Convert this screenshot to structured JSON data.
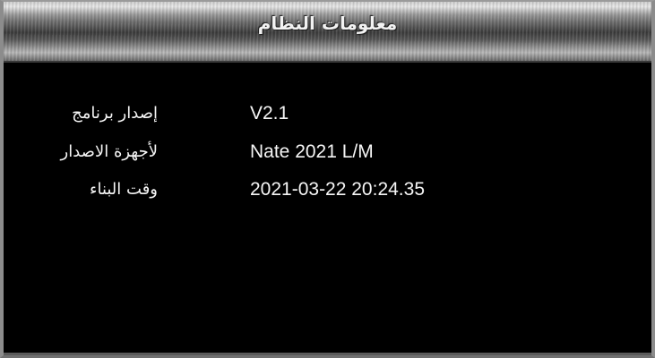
{
  "header": {
    "title": "معلومات النظام"
  },
  "info": {
    "rows": [
      {
        "label": "إصدار برنامج",
        "value": "V2.1"
      },
      {
        "label": "لأجهزة الاصدار",
        "value": "Nate 2021 L/M"
      },
      {
        "label": "وقت البناء",
        "value": "2021-03-22 20:24.35"
      }
    ]
  }
}
